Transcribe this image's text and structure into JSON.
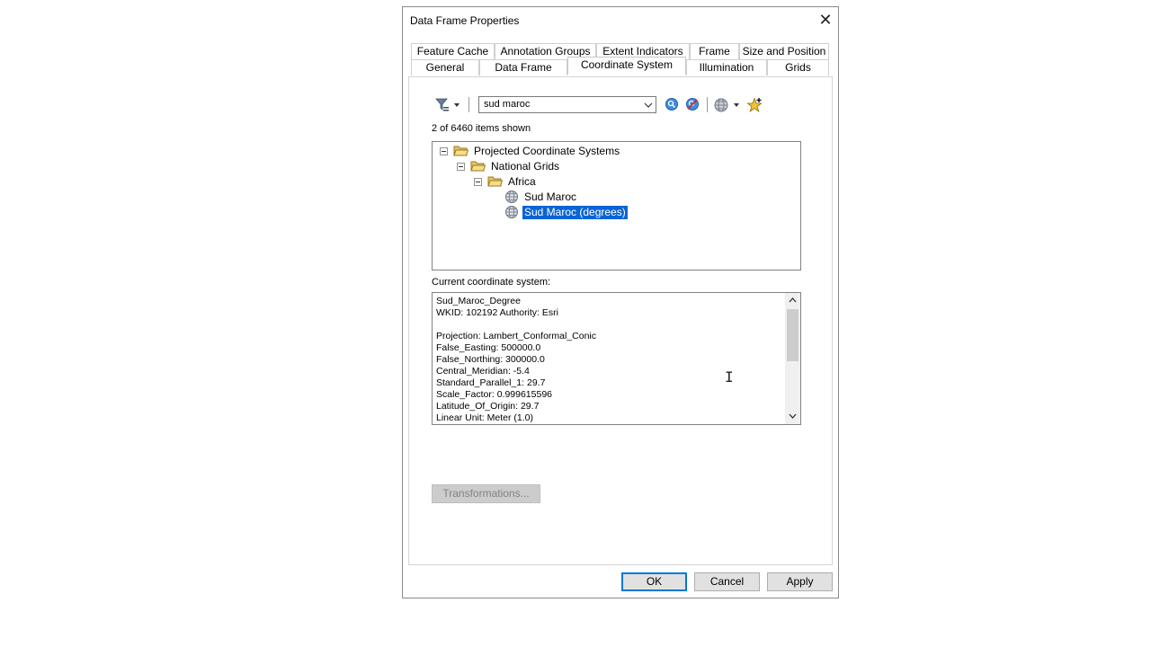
{
  "dialog": {
    "title": "Data Frame Properties",
    "close_glyph": "✕"
  },
  "tabs_top": [
    "Feature Cache",
    "Annotation Groups",
    "Extent Indicators",
    "Frame",
    "Size and Position"
  ],
  "tabs_bottom": [
    "General",
    "Data Frame",
    "Coordinate System",
    "Illumination",
    "Grids"
  ],
  "active_tab": "Coordinate System",
  "toolbar": {
    "search_value": "sud maroc",
    "filter_icon": "filter-icon",
    "search_icon": "search-icon",
    "clear_icon": "clear-search-icon",
    "globe_icon": "globe-icon",
    "favorite_icon": "add-favorite-icon"
  },
  "items_shown": "2 of 6460 items shown",
  "tree": {
    "root": "Projected Coordinate Systems",
    "level1": "National Grids",
    "level2": "Africa",
    "leaf1": "Sud Maroc",
    "leaf2": "Sud Maroc (degrees)"
  },
  "current_cs_label": "Current coordinate system:",
  "current_cs_text": "Sud_Maroc_Degree\nWKID: 102192 Authority: Esri\n\nProjection: Lambert_Conformal_Conic\nFalse_Easting: 500000.0\nFalse_Northing: 300000.0\nCentral_Meridian: -5.4\nStandard_Parallel_1: 29.7\nScale_Factor: 0.999615596\nLatitude_Of_Origin: 29.7\nLinear Unit: Meter (1.0)",
  "buttons": {
    "transformations": "Transformations...",
    "ok": "OK",
    "cancel": "Cancel",
    "apply": "Apply"
  },
  "colors": {
    "selection": "#0a64d4",
    "default_button_border": "#0078d7",
    "folder": "#e8c25e"
  }
}
